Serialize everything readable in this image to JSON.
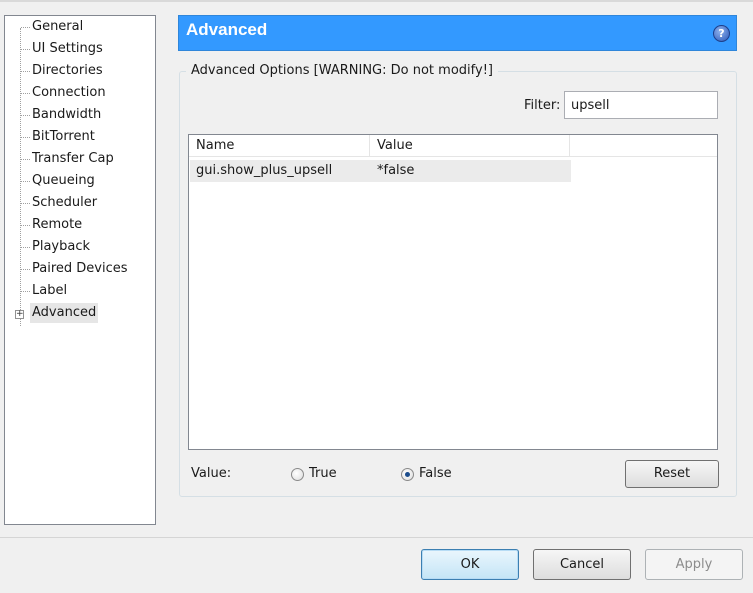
{
  "sidebar": {
    "items": [
      {
        "label": "General"
      },
      {
        "label": "UI Settings"
      },
      {
        "label": "Directories"
      },
      {
        "label": "Connection"
      },
      {
        "label": "Bandwidth"
      },
      {
        "label": "BitTorrent"
      },
      {
        "label": "Transfer Cap"
      },
      {
        "label": "Queueing"
      },
      {
        "label": "Scheduler"
      },
      {
        "label": "Remote"
      },
      {
        "label": "Playback"
      },
      {
        "label": "Paired Devices"
      },
      {
        "label": "Label"
      },
      {
        "label": "Advanced"
      }
    ],
    "selected": "Advanced"
  },
  "header": {
    "title": "Advanced",
    "help_icon": "help-icon",
    "help_glyph": "?"
  },
  "options": {
    "group_title": "Advanced Options [WARNING: Do not modify!]",
    "filter_label": "Filter:",
    "filter_value": "upsell",
    "columns": [
      "Name",
      "Value"
    ],
    "rows": [
      {
        "name": "gui.show_plus_upsell",
        "value": "*false"
      }
    ],
    "value_label": "Value:",
    "radio_true": "True",
    "radio_false": "False",
    "selected_value": "False",
    "reset_label": "Reset"
  },
  "footer": {
    "ok_label": "OK",
    "cancel_label": "Cancel",
    "apply_label": "Apply"
  },
  "colors": {
    "header_bg": "#3399ff",
    "selected_row": "#ebebeb"
  }
}
